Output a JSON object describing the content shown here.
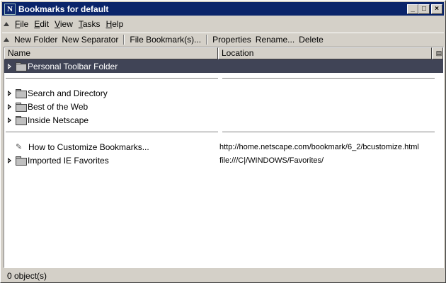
{
  "window": {
    "title": "Bookmarks for default",
    "app_icon_letter": "N",
    "minimize": "_",
    "maximize": "□",
    "close": "×"
  },
  "menu": [
    {
      "label": "File",
      "key": "F"
    },
    {
      "label": "Edit",
      "key": "E"
    },
    {
      "label": "View",
      "key": "V"
    },
    {
      "label": "Tasks",
      "key": "T"
    },
    {
      "label": "Help",
      "key": "H"
    }
  ],
  "toolbar": {
    "new_folder": "New Folder",
    "new_separator": "New Separator",
    "file_bookmark": "File Bookmark(s)...",
    "properties": "Properties",
    "rename": "Rename...",
    "delete": "Delete"
  },
  "columns": {
    "name": "Name",
    "location": "Location"
  },
  "rows": [
    {
      "name": "Personal Toolbar Folder",
      "location": "",
      "type": "folder",
      "selected": true
    },
    {
      "name": "Search and Directory",
      "location": "",
      "type": "folder"
    },
    {
      "name": "Best of the Web",
      "location": "",
      "type": "folder"
    },
    {
      "name": "Inside Netscape",
      "location": "",
      "type": "folder"
    },
    {
      "name": "How to Customize Bookmarks...",
      "location": "http://home.netscape.com/bookmark/6_2/bcustomize.html",
      "type": "bookmark"
    },
    {
      "name": "Imported IE Favorites",
      "location": "file:///C|/WINDOWS/Favorites/",
      "type": "folder"
    }
  ],
  "status": {
    "text": "0 object(s)"
  }
}
